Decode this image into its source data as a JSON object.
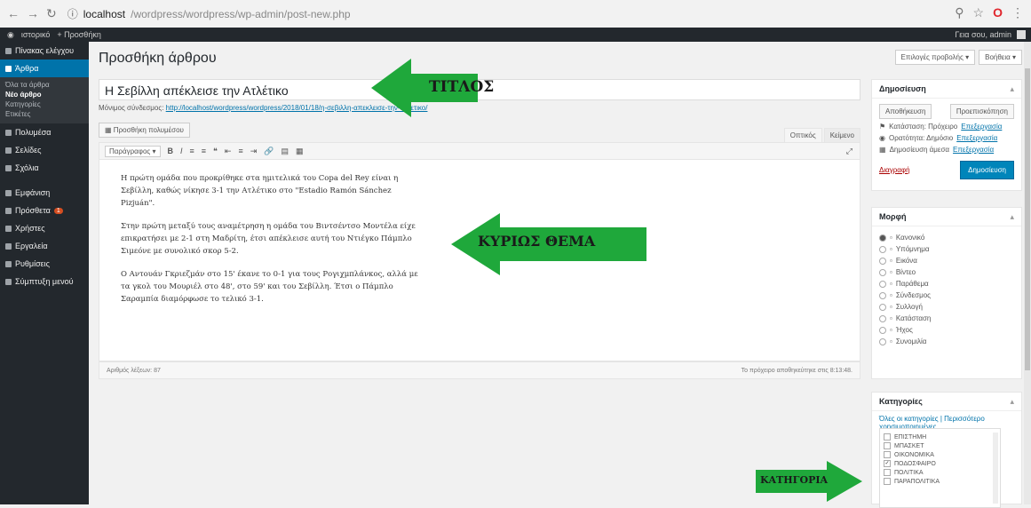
{
  "browser": {
    "url_host": "localhost",
    "url_path": "/wordpress/wordpress/wp-admin/post-new.php"
  },
  "adminbar": {
    "site": "ιστορικό",
    "new": "+ Προσθήκη",
    "greeting": "Γεια σου, admin"
  },
  "sidebar": {
    "items": [
      {
        "label": "Πίνακας ελέγχου"
      },
      {
        "label": "Άρθρα"
      },
      {
        "label": "Πολυμέσα"
      },
      {
        "label": "Σελίδες"
      },
      {
        "label": "Σχόλια"
      },
      {
        "label": "Εμφάνιση"
      },
      {
        "label": "Πρόσθετα",
        "badge": "1"
      },
      {
        "label": "Χρήστες"
      },
      {
        "label": "Εργαλεία"
      },
      {
        "label": "Ρυθμίσεις"
      },
      {
        "label": "Σύμπτυξη μενού"
      }
    ],
    "subitems": [
      "Όλα τα άρθρα",
      "Νέο άρθρο",
      "Κατηγορίες",
      "Ετικέτες"
    ]
  },
  "page": {
    "title": "Προσθήκη άρθρου",
    "screen_options": "Επιλογές προβολής ▾",
    "help": "Βοήθεια ▾",
    "post_title": "Η Σεβίλλη απέκλεισε την Ατλέτικο",
    "permalink_label": "Μόνιμος σύνδεσμος:",
    "permalink_url": "http://localhost/wordpress/wordpress/2018/01/18/η-σεβιλλη-απεκλεισε-την-ατλετικο/",
    "add_media": "Προσθήκη πολυμέσου",
    "tab_visual": "Οπτικός",
    "tab_text": "Κείμενο",
    "format_select": "Παράγραφος",
    "paragraphs": [
      "Η πρώτη ομάδα που προκρίθηκε στα ημιτελικά του Copa del Rey είναι η Σεβίλλη, καθώς νίκησε 3-1 την Ατλέτικο στο \"Estadio Ramón Sánchez Pizjuán\".",
      "Στην πρώτη μεταξύ τους αναμέτρηση η ομάδα του Βιντσέντσο Μοντέλα είχε επικρατήσει με 2-1 στη Μαδρίτη, έτσι απέκλεισε αυτή του Ντιέγκο Πάμπλο Σιμεόνε με συνολικό σκορ 5-2.",
      "Ο Αντουάν Γκριεζμάν στο 15' έκανε το 0-1 για τους Ρογιχμπλάνκος, αλλά με τα γκολ του Μουριέλ στο 48', στο 59' και του Σεβίλλη. Έτσι ο Πάμπλο Σαραμπία διαμόρφωσε το τελικό 3-1."
    ],
    "word_count": "Αριθμός λέξεων: 87",
    "draft_saved": "Το πρόχειρο αποθηκεύτηκε στις 8:13:48."
  },
  "publish": {
    "title": "Δημοσίευση",
    "save_draft": "Αποθήκευση",
    "preview": "Προεπισκόπηση",
    "status": "Κατάσταση: Πρόχειρο",
    "visibility": "Ορατότητα: Δημόσιο",
    "schedule": "Δημοσίευση άμεσα",
    "edit": "Επεξεργασία",
    "trash": "Διαγραφή",
    "publish_btn": "Δημοσίευση"
  },
  "formats": {
    "title": "Μορφή",
    "items": [
      "Κανονικό",
      "Υπόμνημα",
      "Εικόνα",
      "Βίντεο",
      "Παράθεμα",
      "Σύνδεσμος",
      "Συλλογή",
      "Κατάσταση",
      "Ήχος",
      "Συνομιλία"
    ]
  },
  "categories": {
    "title": "Κατηγορίες",
    "tab_all": "Όλες οι κατηγορίες",
    "tab_popular": "Περισσότερο χρησιμοποιημένες",
    "items": [
      {
        "label": "ΕΠΙΣΤΗΜΗ",
        "checked": false
      },
      {
        "label": "ΜΠΑΣΚΕΤ",
        "checked": false
      },
      {
        "label": "ΟΙΚΟΝΟΜΙΚΑ",
        "checked": false
      },
      {
        "label": "ΠΟΔΟΣΦΑΙΡΟ",
        "checked": true
      },
      {
        "label": "ΠΟΛΙΤΙΚΑ",
        "checked": false
      },
      {
        "label": "ΠΑΡΑΠΟΛΙΤΙΚΑ",
        "checked": false
      }
    ]
  },
  "annotations": {
    "title": "ΤΙΤΛΟΣ",
    "content": "ΚΥΡΙΩΣ ΘΕΜΑ",
    "category": "ΚΑΤΗΓΟΡΙΑ",
    "arrow_color": "#1fa83b"
  }
}
